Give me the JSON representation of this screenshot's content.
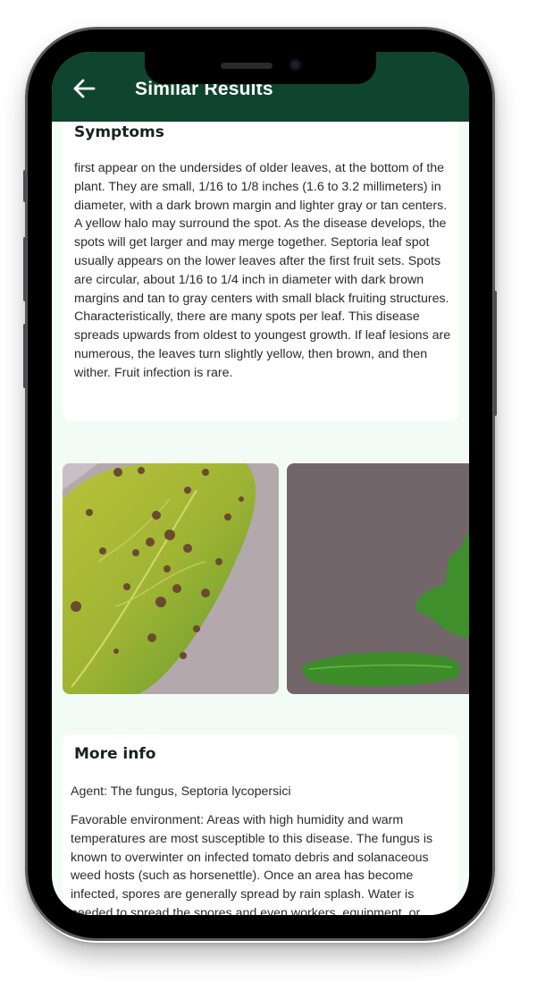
{
  "appbar": {
    "title": "Similar Results",
    "back_icon": "arrow-left-icon",
    "color": "#0f4430"
  },
  "symptoms": {
    "title": "Symptoms",
    "text": "first appear on the undersides of older leaves, at the bottom of the plant. They are small, 1/16 to 1/8 inches (1.6 to 3.2 millimeters) in diameter, with a dark brown margin and lighter gray or tan centers. A yellow halo may surround the spot. As the disease develops, the spots will get larger and may merge together. Septoria leaf spot usually appears on the lower leaves after the first fruit sets. Spots are circular, about 1/16 to 1/4 inch in diameter with dark brown margins and tan to gray centers with small black fruiting structures. Characteristically, there are many spots per leaf. This disease spreads upwards from oldest to youngest growth. If leaf lesions are numerous, the leaves turn slightly yellow, then brown, and then wither. Fruit infection is rare."
  },
  "gallery": {
    "images": [
      {
        "name": "leaf-spots-closeup-image"
      },
      {
        "name": "tomato-leaves-on-pavement-image"
      }
    ]
  },
  "more_info": {
    "title": "More info",
    "agent": "Agent: The fungus, Septoria lycopersici",
    "environment": "Favorable environment: Areas with high humidity and warm temperatures are most susceptible to this disease. The fungus is known to overwinter on infected tomato debris and solanaceous weed hosts (such as horsenettle). Once an area has become infected, spores are generally spread by rain splash. Water is needed to spread the spores and even workers, equipment, or"
  },
  "colors": {
    "screen_bg": "#f2fbf6",
    "card_bg": "#ffffff",
    "text": "#2b2b2b"
  }
}
